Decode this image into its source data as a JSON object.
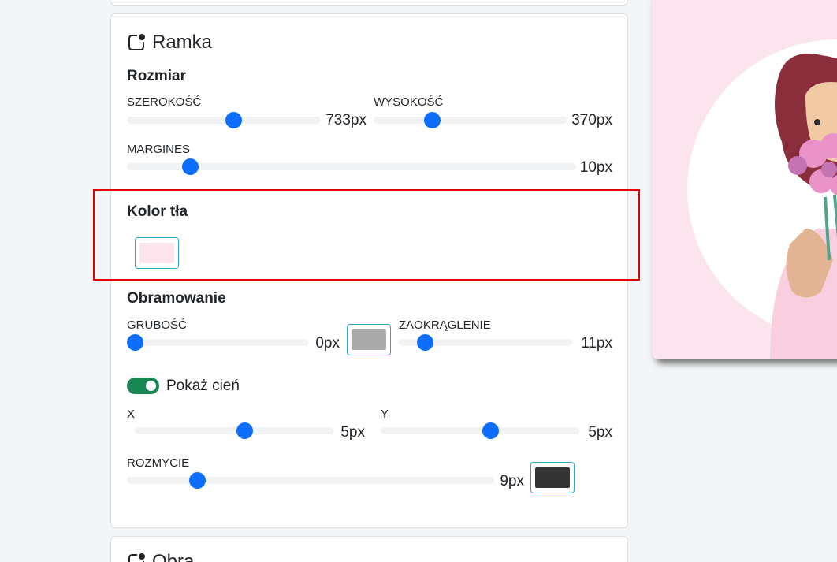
{
  "frame_panel": {
    "title": "Ramka",
    "title_icon": "frame-icon",
    "size_section": {
      "heading": "Rozmiar",
      "width_label": "SZEROKOŚĆ",
      "width_value": "733px",
      "width_level": 0.55,
      "height_label": "WYSOKOŚĆ",
      "height_value": "370px",
      "height_level": 0.3,
      "margin_label": "MARGINES",
      "margin_value": "10px",
      "margin_level": 0.14
    },
    "background_section": {
      "heading": "Kolor tła",
      "color": "#fce4ec"
    },
    "border_section": {
      "heading": "Obramowanie",
      "thickness_label": "GRUBOŚĆ",
      "thickness_value": "0px",
      "thickness_level": 0.0,
      "border_color": "#a9a9a9",
      "radius_label": "ZAOKRĄGLENIE",
      "radius_value": "11px",
      "radius_level": 0.15
    },
    "shadow_section": {
      "toggle_label": "Pokaż cień",
      "toggle_on": true,
      "x_label": "X",
      "x_value": "5px",
      "x_level": 0.55,
      "y_label": "Y",
      "y_value": "5px",
      "y_level": 0.55,
      "blur_label": "ROZMYCIE",
      "blur_value": "9px",
      "blur_level": 0.19,
      "shadow_color": "#333333"
    }
  },
  "next_panel": {
    "title_fragment": "Obra..."
  },
  "colors": {
    "accent": "#0d6efd",
    "toggle_on": "#198754",
    "highlight": "#e30000",
    "preview_background": "#fce4ee"
  }
}
